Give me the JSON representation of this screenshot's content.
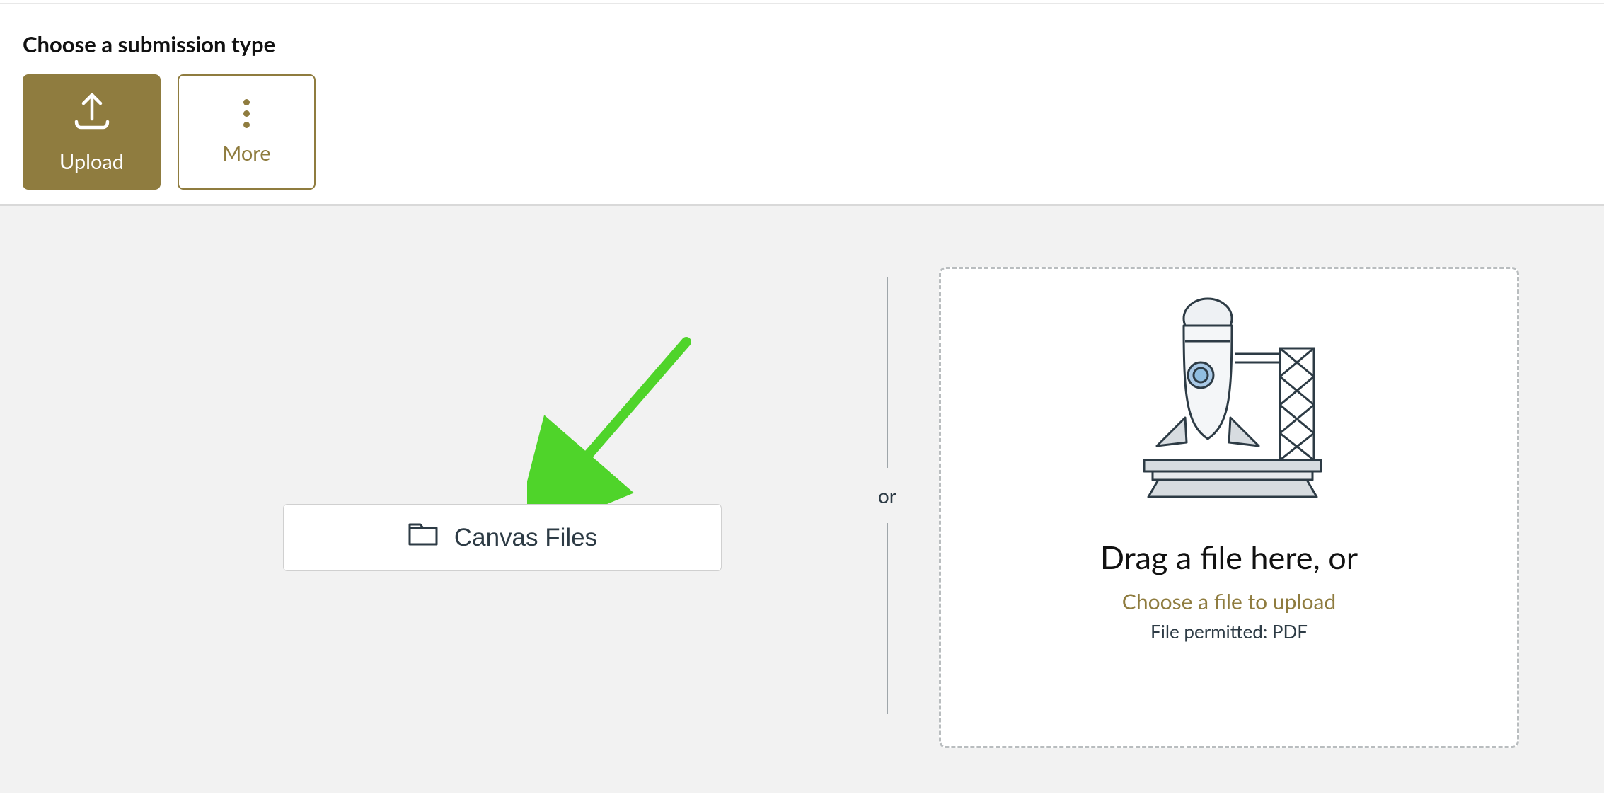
{
  "heading": "Choose a submission type",
  "tabs": {
    "upload": "Upload",
    "more": "More"
  },
  "canvas_files_button": "Canvas Files",
  "separator": "or",
  "drop": {
    "title": "Drag a file here, or",
    "choose": "Choose a file to upload",
    "permitted": "File permitted: PDF"
  }
}
